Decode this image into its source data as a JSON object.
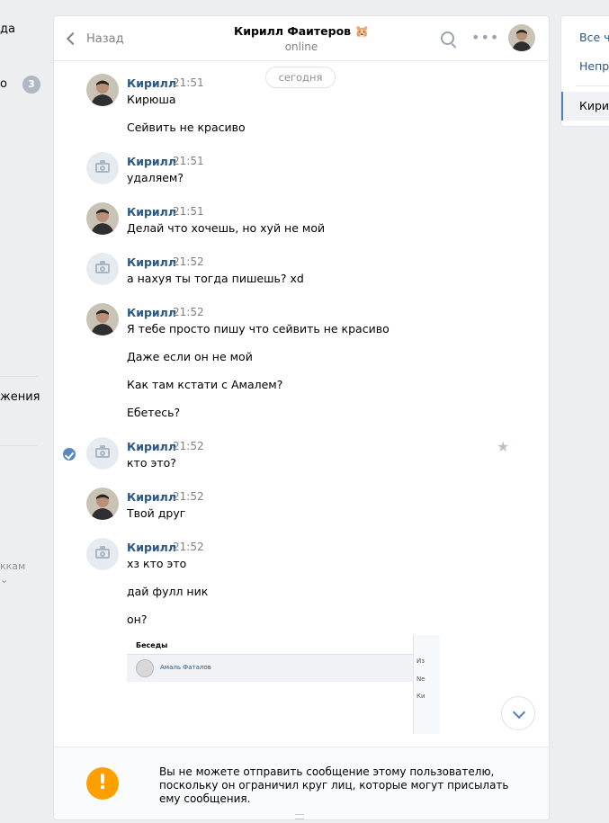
{
  "left_nav": {
    "item1": "да",
    "item2": "о",
    "badge": "3",
    "item3": "жения",
    "item4": "ккам",
    "item5": "⌄"
  },
  "header": {
    "back_label": "Назад",
    "title": "Кирилл Фаитеров 🐹",
    "status": "online"
  },
  "date_divider": "сегодня",
  "messages": [
    {
      "author": "Кирилл",
      "time": "21:51",
      "lines": [
        "Кирюша",
        "Сейвить не красиво"
      ]
    },
    {
      "author": "Кирилл",
      "time": "21:51",
      "lines": [
        "удаляем?"
      ]
    },
    {
      "author": "Кирилл",
      "time": "21:51",
      "lines": [
        "Делай что хочешь, но хуй не мой"
      ]
    },
    {
      "author": "Кирилл",
      "time": "21:52",
      "lines": [
        "а нахуя ты тогда пишешь? xd"
      ]
    },
    {
      "author": "Кирилл",
      "time": "21:52",
      "lines": [
        "Я тебе просто пишу что сейвить не красиво",
        "Даже если он не мой",
        "Как там кстати с Амалем?",
        "Ебетесь?"
      ]
    },
    {
      "author": "Кирилл",
      "time": "21:52",
      "lines": [
        "кто это?"
      ]
    },
    {
      "author": "Кирилл",
      "time": "21:52",
      "lines": [
        "Твой друг"
      ]
    },
    {
      "author": "Кирилл",
      "time": "21:52",
      "lines": [
        "хз кто это",
        "дай фулл ник",
        "он?"
      ]
    }
  ],
  "embed": {
    "title": "Беседы",
    "contact": "Амаль Фаталов",
    "side": [
      "Из",
      "Ne",
      "Ки"
    ]
  },
  "footer": {
    "notice": "Вы не можете отправить сообщение этому пользователю, поскольку он ограничил круг лиц, которые могут присылать ему сообщения."
  },
  "right_panel": {
    "all": "Все ча",
    "unread": "Непро",
    "active": "Кирил"
  },
  "colors": {
    "link": "#2a5885",
    "accent": "#5181b8",
    "warning": "#ffa000"
  }
}
